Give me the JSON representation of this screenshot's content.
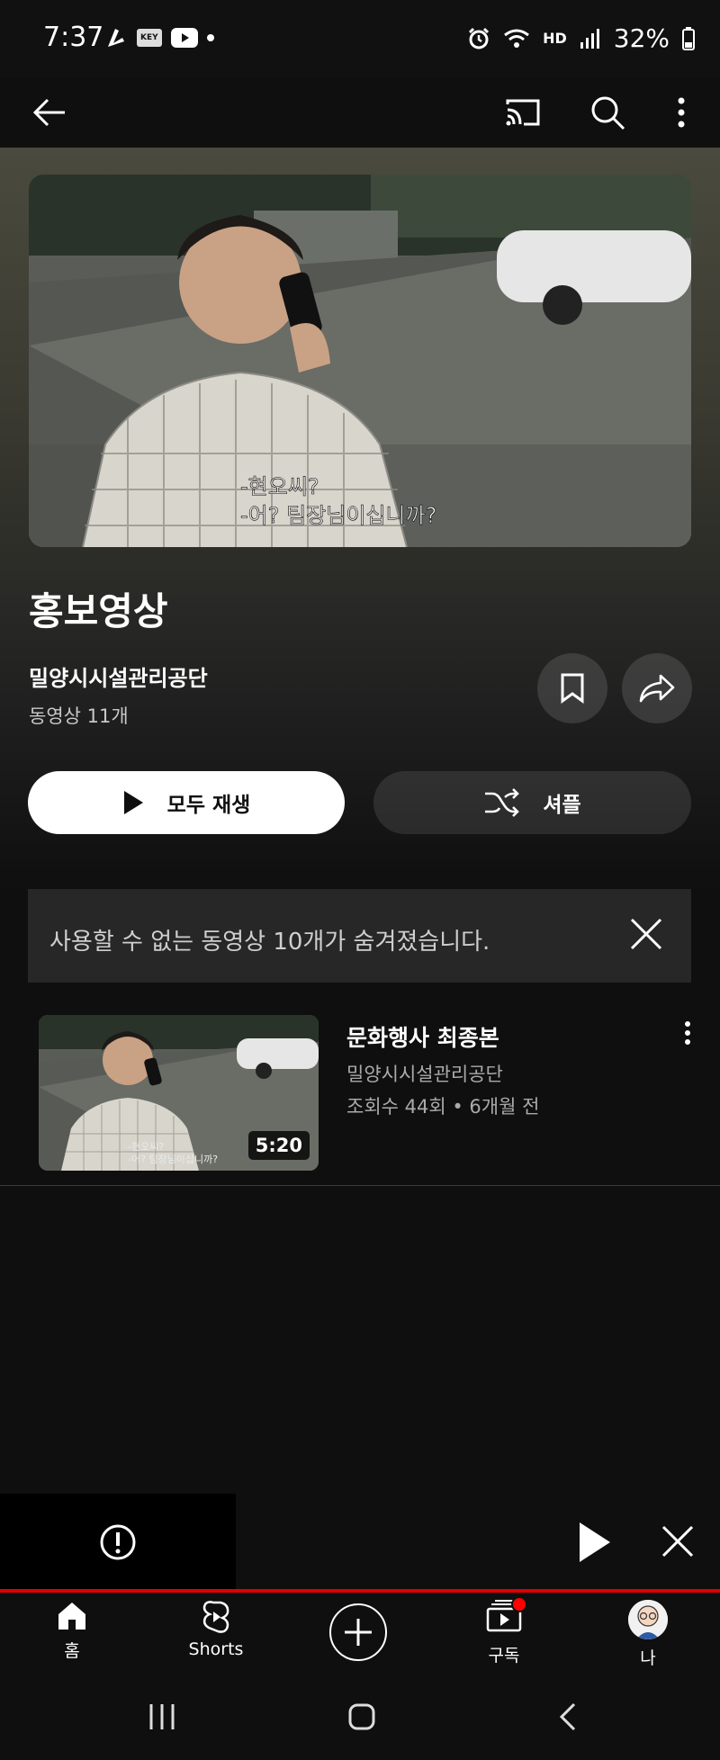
{
  "status_bar": {
    "time": "7:37",
    "left_badge": "KEY",
    "network_label": "HD",
    "battery": "32%"
  },
  "playlist": {
    "title": "홍보영상",
    "channel": "밀양시시설관리공단",
    "video_count": "동영상 11개",
    "hero_caption_line1": "-현오씨?",
    "hero_caption_line2": "-어? 팀장님이십니까?"
  },
  "actions": {
    "play_all_label": "모두 재생",
    "shuffle_label": "셔플"
  },
  "notice": {
    "text": "사용할 수 없는 동영상 10개가 숨겨졌습니다."
  },
  "videos": [
    {
      "title": "문화행사 최종본",
      "channel": "밀양시시설관리공단",
      "meta": "조회수 44회 • 6개월 전",
      "duration": "5:20",
      "caption_line1": "-현오씨?",
      "caption_line2": "-어? 팀장님이십니까?"
    }
  ],
  "bottom_nav": {
    "home_label": "홈",
    "shorts_label": "Shorts",
    "subscriptions_label": "구독",
    "me_label": "나"
  },
  "colors": {
    "accent": "#ff0000",
    "background": "#0f0f0f",
    "notice_bg": "#272727"
  },
  "icons": [
    "back-arrow-icon",
    "cast-icon",
    "search-icon",
    "more-vert-icon",
    "bookmark-icon",
    "share-icon",
    "play-icon",
    "shuffle-icon",
    "close-icon",
    "alert-icon",
    "home-icon",
    "shorts-icon",
    "create-icon",
    "subscriptions-icon",
    "avatar"
  ]
}
